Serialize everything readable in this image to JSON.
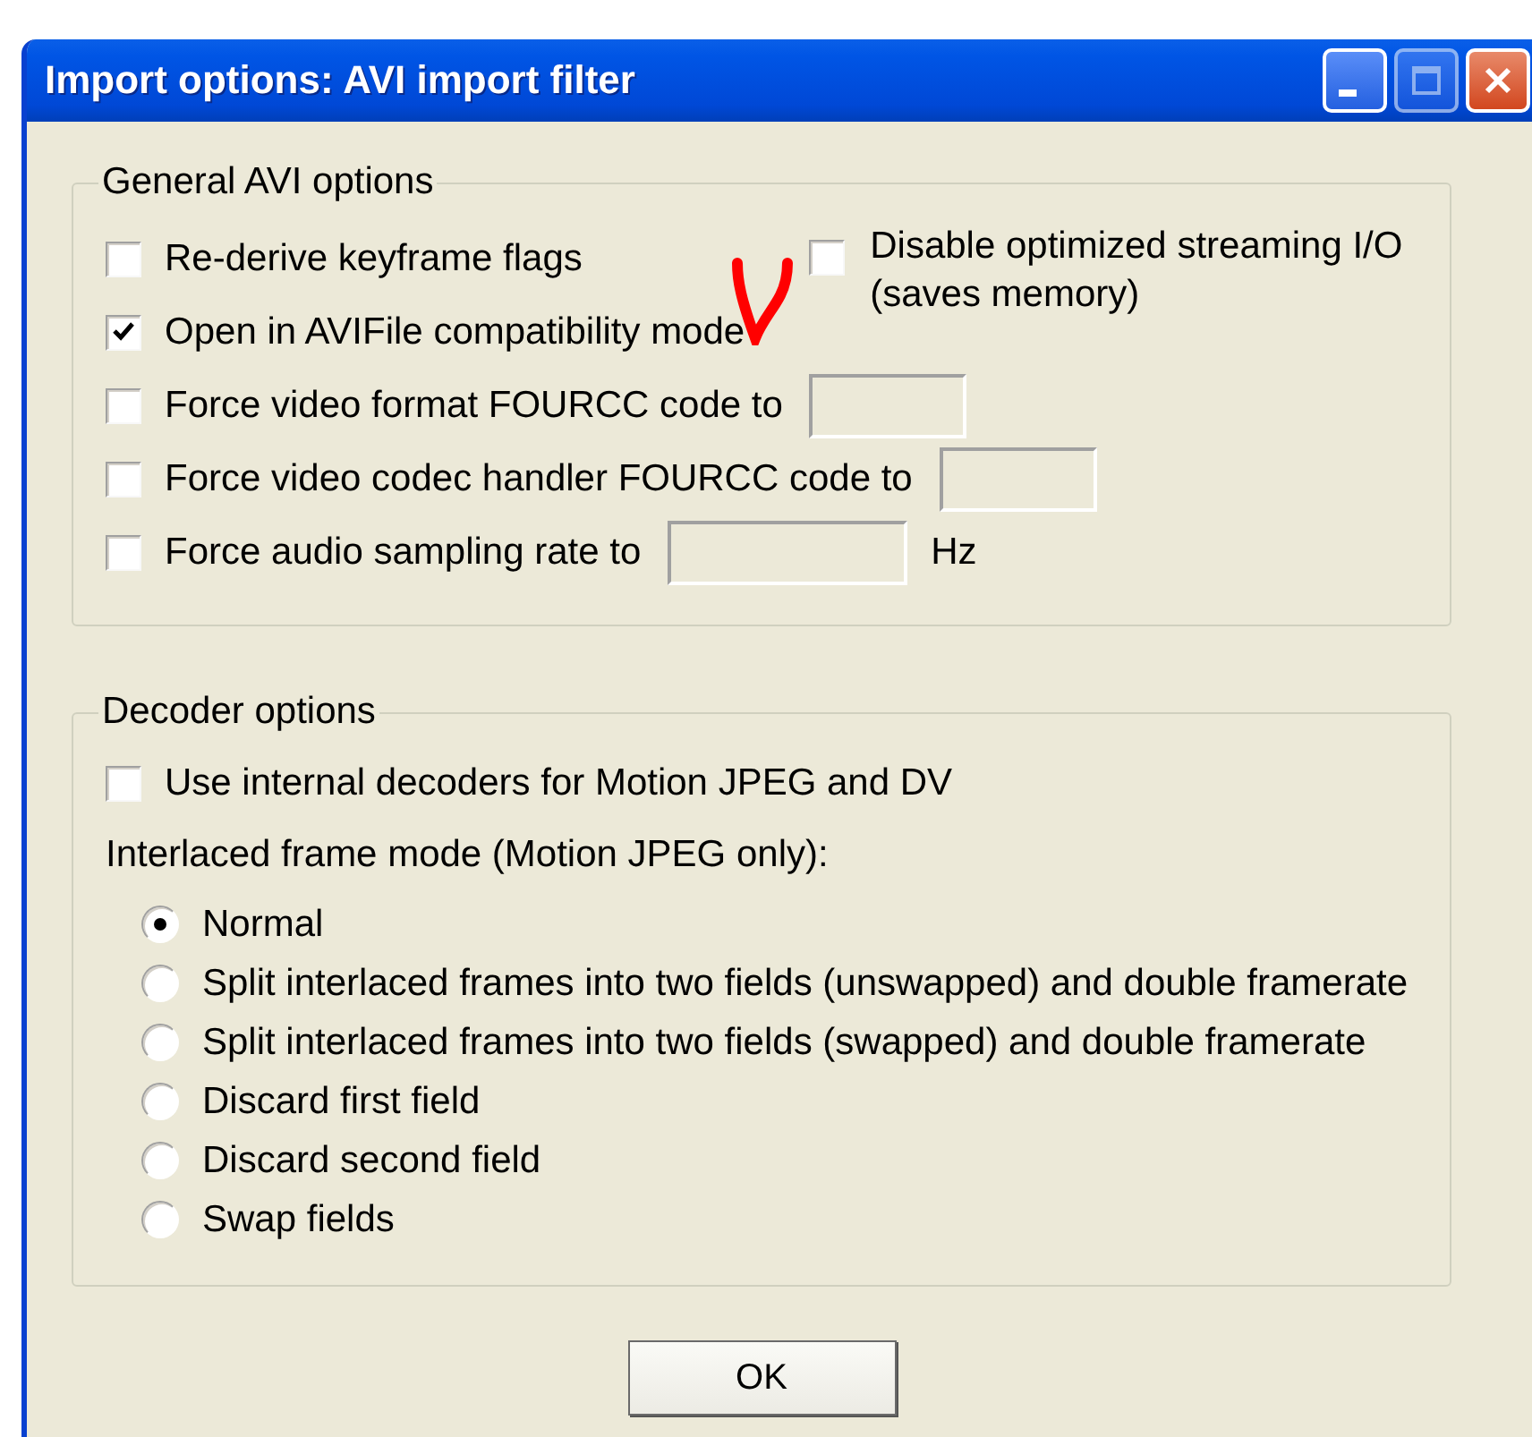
{
  "window": {
    "title": "Import options: AVI import filter"
  },
  "general": {
    "legend": "General AVI options",
    "side_option": {
      "label": "Disable optimized streaming I/O (saves memory)",
      "checked": false
    },
    "options": [
      {
        "kind": "plain",
        "label": "Re-derive keyframe flags",
        "checked": false
      },
      {
        "kind": "plain",
        "label": "Open in AVIFile compatibility mode",
        "checked": true
      },
      {
        "kind": "field",
        "label": "Force video format FOURCC code to",
        "checked": false
      },
      {
        "kind": "field",
        "label": "Force video codec handler FOURCC code to",
        "checked": false
      },
      {
        "kind": "field",
        "label": "Force audio sampling rate to",
        "checked": false,
        "unit": "Hz"
      }
    ]
  },
  "decoder": {
    "legend": "Decoder options",
    "internal_decoders": {
      "label": "Use internal decoders for Motion JPEG and DV",
      "checked": false
    },
    "mode_label": "Interlaced frame mode (Motion JPEG only):",
    "modes": [
      {
        "label": "Normal",
        "selected": true
      },
      {
        "label": "Split interlaced frames into two fields (unswapped) and double framerate",
        "selected": false
      },
      {
        "label": "Split interlaced frames into two fields (swapped) and double framerate",
        "selected": false
      },
      {
        "label": "Discard first field",
        "selected": false
      },
      {
        "label": "Discard second field",
        "selected": false
      },
      {
        "label": "Swap fields",
        "selected": false
      }
    ]
  },
  "buttons": [
    {
      "label": "OK"
    }
  ]
}
